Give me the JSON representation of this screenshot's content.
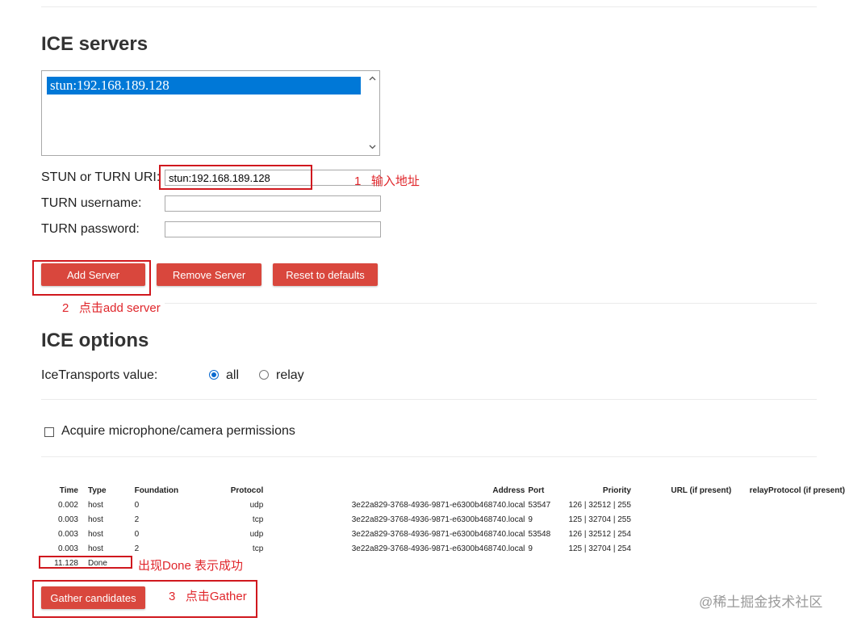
{
  "ice_servers": {
    "heading": "ICE servers",
    "list_items": [
      "stun:192.168.189.128"
    ],
    "uri_label": "STUN or TURN URI:",
    "uri_value": "stun:192.168.189.128",
    "username_label": "TURN username:",
    "username_value": "",
    "password_label": "TURN password:",
    "password_value": "",
    "add_button": "Add Server",
    "remove_button": "Remove Server",
    "reset_button": "Reset to defaults"
  },
  "ice_options": {
    "heading": "ICE options",
    "transports_label": "IceTransports value:",
    "option_all": "all",
    "option_relay": "relay",
    "selected": "all"
  },
  "permissions": {
    "label": "Acquire microphone/camera permissions",
    "checked": false
  },
  "candidates": {
    "headers": [
      "Time",
      "Type",
      "Foundation",
      "Protocol",
      "Address",
      "Port",
      "Priority",
      "URL (if present)",
      "relayProtocol (if present)"
    ],
    "rows": [
      {
        "time": "0.002",
        "type": "host",
        "foundation": "0",
        "protocol": "udp",
        "address": "3e22a829-3768-4936-9871-e6300b468740.local",
        "port": "53547",
        "priority": "126 | 32512 | 255"
      },
      {
        "time": "0.003",
        "type": "host",
        "foundation": "2",
        "protocol": "tcp",
        "address": "3e22a829-3768-4936-9871-e6300b468740.local",
        "port": "9",
        "priority": "125 | 32704 | 255"
      },
      {
        "time": "0.003",
        "type": "host",
        "foundation": "0",
        "protocol": "udp",
        "address": "3e22a829-3768-4936-9871-e6300b468740.local",
        "port": "53548",
        "priority": "126 | 32512 | 254"
      },
      {
        "time": "0.003",
        "type": "host",
        "foundation": "2",
        "protocol": "tcp",
        "address": "3e22a829-3768-4936-9871-e6300b468740.local",
        "port": "9",
        "priority": "125 | 32704 | 254"
      }
    ],
    "done_time": "11.128",
    "done_label": "Done",
    "gather_button": "Gather candidates"
  },
  "annotations": {
    "step1": "1   输入地址",
    "step2": "2   点击add server",
    "done_note": "出现Done 表示成功",
    "step3": "3   点击Gather"
  },
  "watermark": "@稀土掘金技术社区",
  "colors": {
    "button_red": "#d9473d",
    "annotation_red": "#e0262b",
    "selection_blue": "#0078d7"
  }
}
